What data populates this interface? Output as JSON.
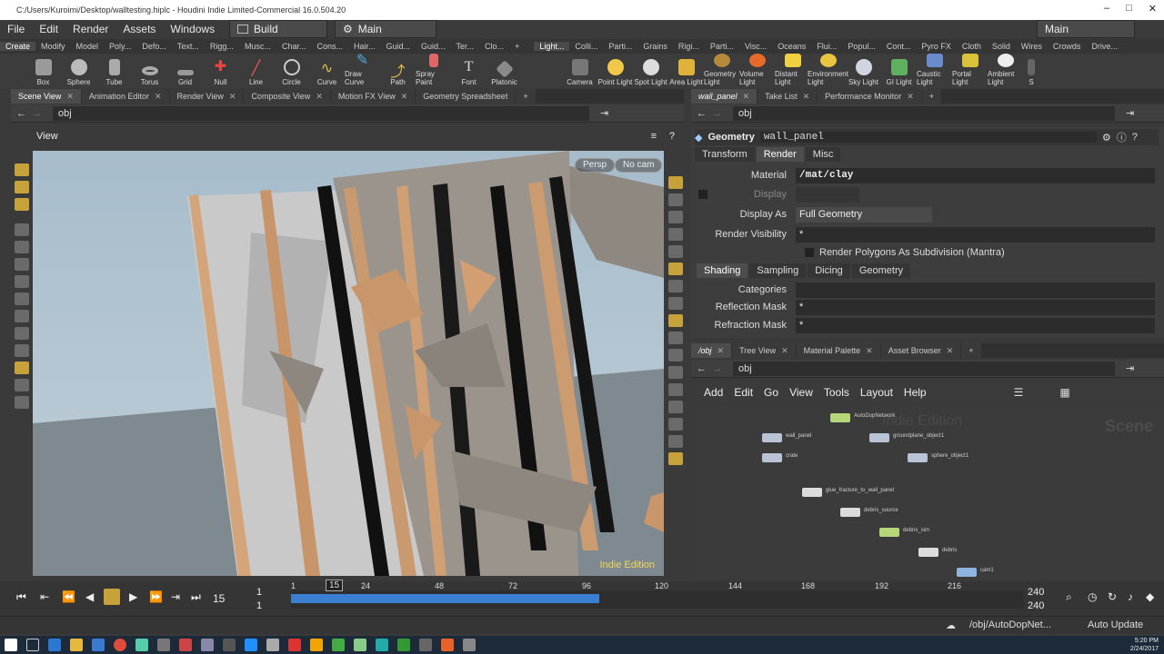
{
  "window": {
    "title": "C:/Users/Kuroimi/Desktop/walltesting.hiplc - Houdini Indie Limited-Commercial 16.0.504.20",
    "controls": [
      "–",
      "□",
      "✕"
    ]
  },
  "menubar": {
    "items": [
      "File",
      "Edit",
      "Render",
      "Assets",
      "Windows",
      "Help"
    ],
    "desktop": "Build",
    "desktop2": "Main",
    "desktop3": "Main"
  },
  "shelf_tabs_left": [
    "Create",
    "Modify",
    "Model",
    "Poly...",
    "Defo...",
    "Text...",
    "Rigg...",
    "Musc...",
    "Char...",
    "Cons...",
    "Hair...",
    "Guid...",
    "Guid...",
    "Ter...",
    "Clo..."
  ],
  "shelf_tabs_right": [
    "Light...",
    "Colli...",
    "Parti...",
    "Grains",
    "Rigi...",
    "Parti...",
    "Visc...",
    "Oceans",
    "Flui...",
    "Popul...",
    "Cont...",
    "Pyro FX",
    "Cloth",
    "Solid",
    "Wires",
    "Crowds",
    "Drive..."
  ],
  "shelf_tools_left": [
    "Box",
    "Sphere",
    "Tube",
    "Torus",
    "Grid",
    "Null",
    "Line",
    "Circle",
    "Curve",
    "Draw Curve",
    "Path",
    "Spray Paint",
    "Font",
    "Platonic"
  ],
  "shelf_tools_right": [
    "Camera",
    "Point Light",
    "Spot Light",
    "Area Light",
    "Geometry Light",
    "Volume Light",
    "Distant Light",
    "Environment Light",
    "Sky Light",
    "GI Light",
    "Caustic Light",
    "Portal Light",
    "Ambient Light",
    "S"
  ],
  "left_pane_tabs": [
    "Scene View",
    "Animation Editor",
    "Render View",
    "Composite View",
    "Motion FX View",
    "Geometry Spreadsheet"
  ],
  "right_pane_tabs": [
    "wall_panel",
    "Take List",
    "Performance Monitor"
  ],
  "left_path": "obj",
  "right_path": "obj",
  "viewport": {
    "header": "View",
    "persp": "Persp",
    "cam": "No cam",
    "watermark": "Indie Edition"
  },
  "params": {
    "type": "Geometry",
    "name": "wall_panel",
    "tabs": [
      "Transform",
      "Render",
      "Misc"
    ],
    "material_label": "Material",
    "material_value": "/mat/clay",
    "display_label": "Display",
    "display_as_label": "Display As",
    "display_as_value": "Full Geometry",
    "render_vis_label": "Render Visibility",
    "render_vis_value": "*",
    "subdiv_label": "Render Polygons As Subdivision (Mantra)",
    "subtabs": [
      "Shading",
      "Sampling",
      "Dicing",
      "Geometry"
    ],
    "categories_label": "Categories",
    "reflection_label": "Reflection Mask",
    "reflection_value": "*",
    "refraction_label": "Refraction Mask",
    "refraction_value": "*"
  },
  "network_tabs": [
    "/obj",
    "Tree View",
    "Material Palette",
    "Asset Browser"
  ],
  "network_path": "obj",
  "network_menu": [
    "Add",
    "Edit",
    "Go",
    "View",
    "Tools",
    "Layout",
    "Help"
  ],
  "network": {
    "watermark": "Indie Edition",
    "context": "Scene",
    "nodes": [
      {
        "label": "AutoDopNetwork",
        "color": "#b6d67a"
      },
      {
        "label": "wall_panel",
        "color": "#b9c3d6"
      },
      {
        "label": "groundplane_object1",
        "color": "#b9c3d6"
      },
      {
        "label": "crate",
        "color": "#b9c3d6"
      },
      {
        "label": "sphere_object1",
        "color": "#b9c3d6"
      },
      {
        "label": "glue_fracture_to_wall_panel",
        "color": "#dcdcdc"
      },
      {
        "label": "debris_source",
        "color": "#dcdcdc"
      },
      {
        "label": "debris_sim",
        "color": "#b6d67a"
      },
      {
        "label": "debris",
        "color": "#dcdcdc"
      },
      {
        "label": "cam1",
        "color": "#8fb3df"
      }
    ]
  },
  "playbar": {
    "current_frame": "15",
    "start": "1",
    "start2": "1",
    "end": "240",
    "end2": "240",
    "ticks": [
      "1",
      "24",
      "48",
      "72",
      "96",
      "120",
      "144",
      "168",
      "192",
      "216"
    ],
    "cursor": "15",
    "cached_fraction": 0.42
  },
  "statusbar": {
    "path": "/obj/AutoDopNet...",
    "update": "Auto Update"
  },
  "taskbar": {
    "time": "5:20 PM",
    "date": "2/24/2017"
  }
}
